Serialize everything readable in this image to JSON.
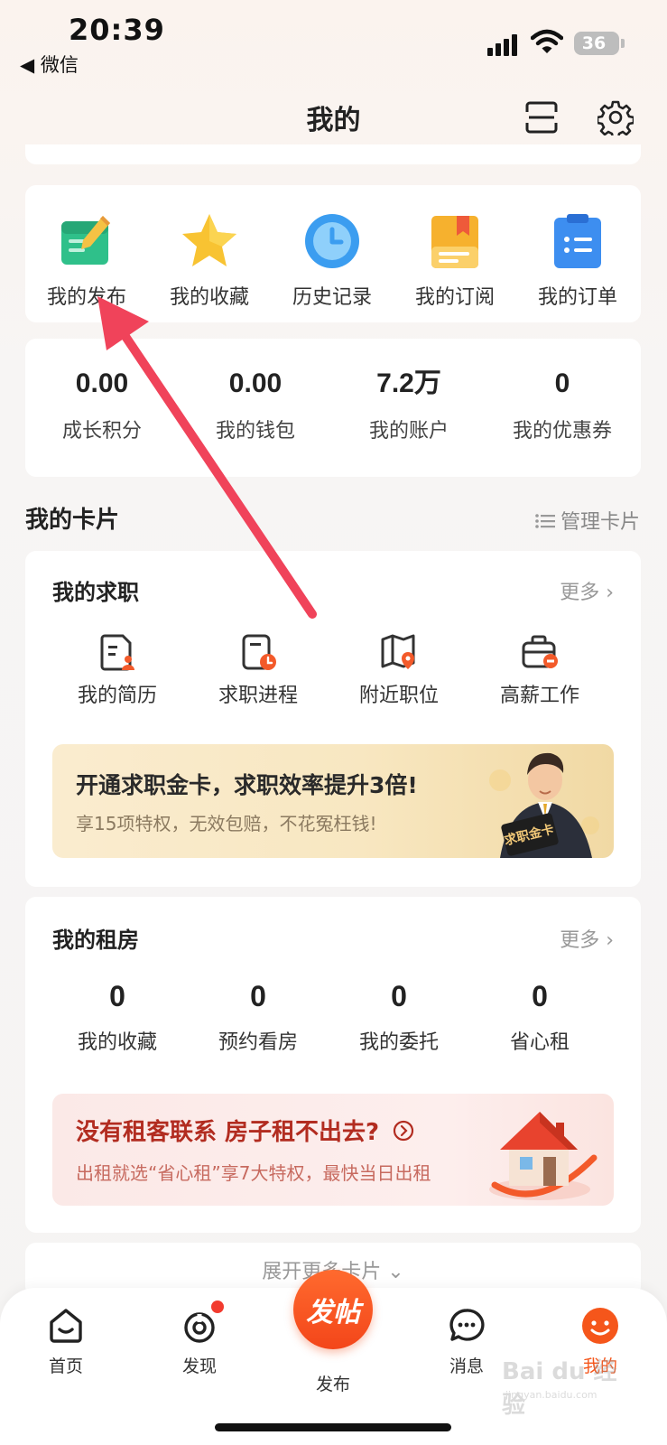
{
  "status_bar": {
    "time": "20:39",
    "back_app": "◀ 微信",
    "battery": "36"
  },
  "header": {
    "title": "我的"
  },
  "quick_actions": [
    {
      "label": "我的发布",
      "icon": "edit-note-icon"
    },
    {
      "label": "我的收藏",
      "icon": "star-icon"
    },
    {
      "label": "历史记录",
      "icon": "clock-icon"
    },
    {
      "label": "我的订阅",
      "icon": "bookmark-doc-icon"
    },
    {
      "label": "我的订单",
      "icon": "clipboard-list-icon"
    }
  ],
  "stats": [
    {
      "value": "0.00",
      "label": "成长积分"
    },
    {
      "value": "0.00",
      "label": "我的钱包"
    },
    {
      "value": "7.2万",
      "label": "我的账户"
    },
    {
      "value": "0",
      "label": "我的优惠券"
    }
  ],
  "cards_section": {
    "title": "我的卡片",
    "manage_label": "管理卡片"
  },
  "job_card": {
    "title": "我的求职",
    "more": "更多 ›",
    "items": [
      {
        "label": "我的简历",
        "icon": "resume-icon"
      },
      {
        "label": "求职进程",
        "icon": "progress-clock-icon"
      },
      {
        "label": "附近职位",
        "icon": "map-pin-icon"
      },
      {
        "label": "高薪工作",
        "icon": "briefcase-icon"
      }
    ],
    "banner": {
      "title": "开通求职金卡，求职效率提升3倍!",
      "subtitle": "享15项特权，无效包赔，不花冤枉钱!",
      "card_text": "求职金卡"
    }
  },
  "rent_card": {
    "title": "我的租房",
    "more": "更多 ›",
    "items": [
      {
        "value": "0",
        "label": "我的收藏"
      },
      {
        "value": "0",
        "label": "预约看房"
      },
      {
        "value": "0",
        "label": "我的委托"
      },
      {
        "value": "0",
        "label": "省心租"
      }
    ],
    "banner": {
      "title": "没有租客联系 房子租不出去?",
      "subtitle": "出租就选“省心租”享7大特权，最快当日出租"
    }
  },
  "expand": {
    "label": "展开更多卡片 ⌄"
  },
  "tabbar": {
    "tabs": [
      {
        "label": "首页",
        "icon": "home-icon"
      },
      {
        "label": "发现",
        "icon": "discover-icon"
      },
      {
        "label": "发布",
        "icon": "publish-icon"
      },
      {
        "label": "消息",
        "icon": "message-icon"
      },
      {
        "label": "我的",
        "icon": "profile-icon"
      }
    ],
    "publish_button": "发帖",
    "active_color": "#f5561b"
  },
  "watermark": {
    "text": "Bai du 经验",
    "sub": "jingyan.baidu.com"
  },
  "colors": {
    "accent": "#f5561b",
    "annotation_arrow": "#f0435a"
  }
}
